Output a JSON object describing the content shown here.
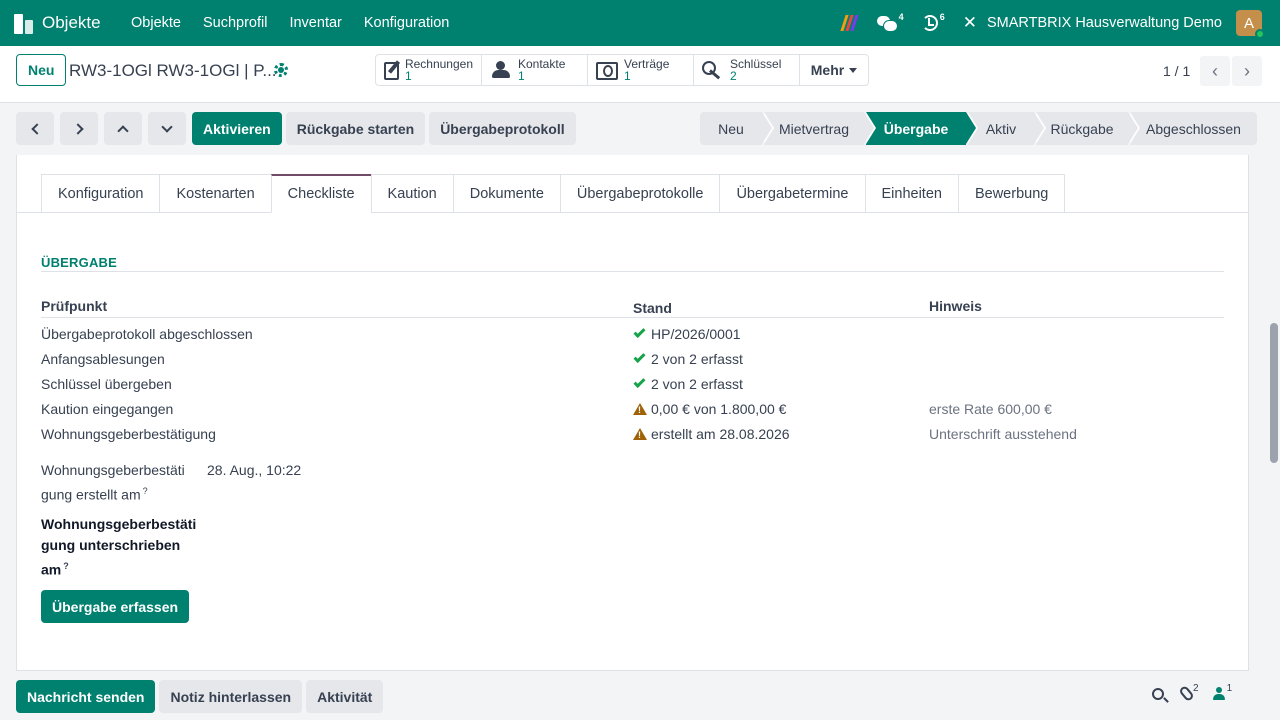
{
  "navbar": {
    "app_name": "Objekte",
    "menu": [
      "Objekte",
      "Suchprofil",
      "Inventar",
      "Konfiguration"
    ],
    "chat_count": "4",
    "activity_count": "6",
    "company": "SMARTBRIX Hausverwaltung Demo",
    "avatar_letter": "A",
    "accent_color": "#00806f"
  },
  "control_panel": {
    "new_label": "Neu",
    "record_title": "RW3-1OGl RW3-1OGl | P...",
    "smart_buttons": [
      {
        "label": "Rechnungen",
        "value": "1",
        "icon": "invoice-edit-icon"
      },
      {
        "label": "Kontakte",
        "value": "1",
        "icon": "users-icon"
      },
      {
        "label": "Verträge",
        "value": "1",
        "icon": "money-icon"
      },
      {
        "label": "Schlüssel",
        "value": "2",
        "icon": "key-icon"
      }
    ],
    "more_label": "Mehr",
    "pager": "1 / 1"
  },
  "actions": {
    "activate": "Aktivieren",
    "start_return": "Rückgabe starten",
    "protocol": "Übergabeprotokoll"
  },
  "statusbar": {
    "stages": [
      "Neu",
      "Mietvertrag",
      "Übergabe",
      "Aktiv",
      "Rückgabe",
      "Abgeschlossen"
    ],
    "active": "Übergabe"
  },
  "tabs": [
    "Konfiguration",
    "Kostenarten",
    "Checkliste",
    "Kaution",
    "Dokumente",
    "Übergabeprotokolle",
    "Übergabetermine",
    "Einheiten",
    "Bewerbung"
  ],
  "active_tab": "Checkliste",
  "section": {
    "title": "ÜBERGABE",
    "columns": [
      "Prüfpunkt",
      "Stand",
      "Hinweis"
    ],
    "rows": [
      {
        "check": "Übergabeprotokoll abgeschlossen",
        "status_icon": "check",
        "status": "HP/2026/0001",
        "note": ""
      },
      {
        "check": "Anfangsablesungen",
        "status_icon": "check",
        "status": "2 von 2 erfasst",
        "note": ""
      },
      {
        "check": "Schlüssel übergeben",
        "status_icon": "check",
        "status": "2 von 2 erfasst",
        "note": ""
      },
      {
        "check": "Kaution eingegangen",
        "status_icon": "warning",
        "status": "0,00 € von 1.800,00 €",
        "note": "erste Rate 600,00 €"
      },
      {
        "check": "Wohnungsgeberbestätigung",
        "status_icon": "warning",
        "status": "erstellt am 28.08.2026",
        "note": "Unterschrift ausstehend"
      }
    ]
  },
  "fields": {
    "created_label": "Wohnungsgeberbestätigung erstellt am",
    "created_label_line1": "Wohnungsgeberbestäti",
    "created_label_line2": "gung erstellt am",
    "created_value": "28. Aug., 10:22",
    "signed_label_line1": "Wohnungsgeberbestäti",
    "signed_label_line2": "gung unterschrieben",
    "signed_label_line3": "am",
    "help_mark": "?"
  },
  "handover_button": "Übergabe erfassen",
  "chatter": {
    "send_message": "Nachricht senden",
    "log_note": "Notiz hinterlassen",
    "activity": "Aktivität",
    "attachments_count": "2",
    "followers_count": "1"
  }
}
